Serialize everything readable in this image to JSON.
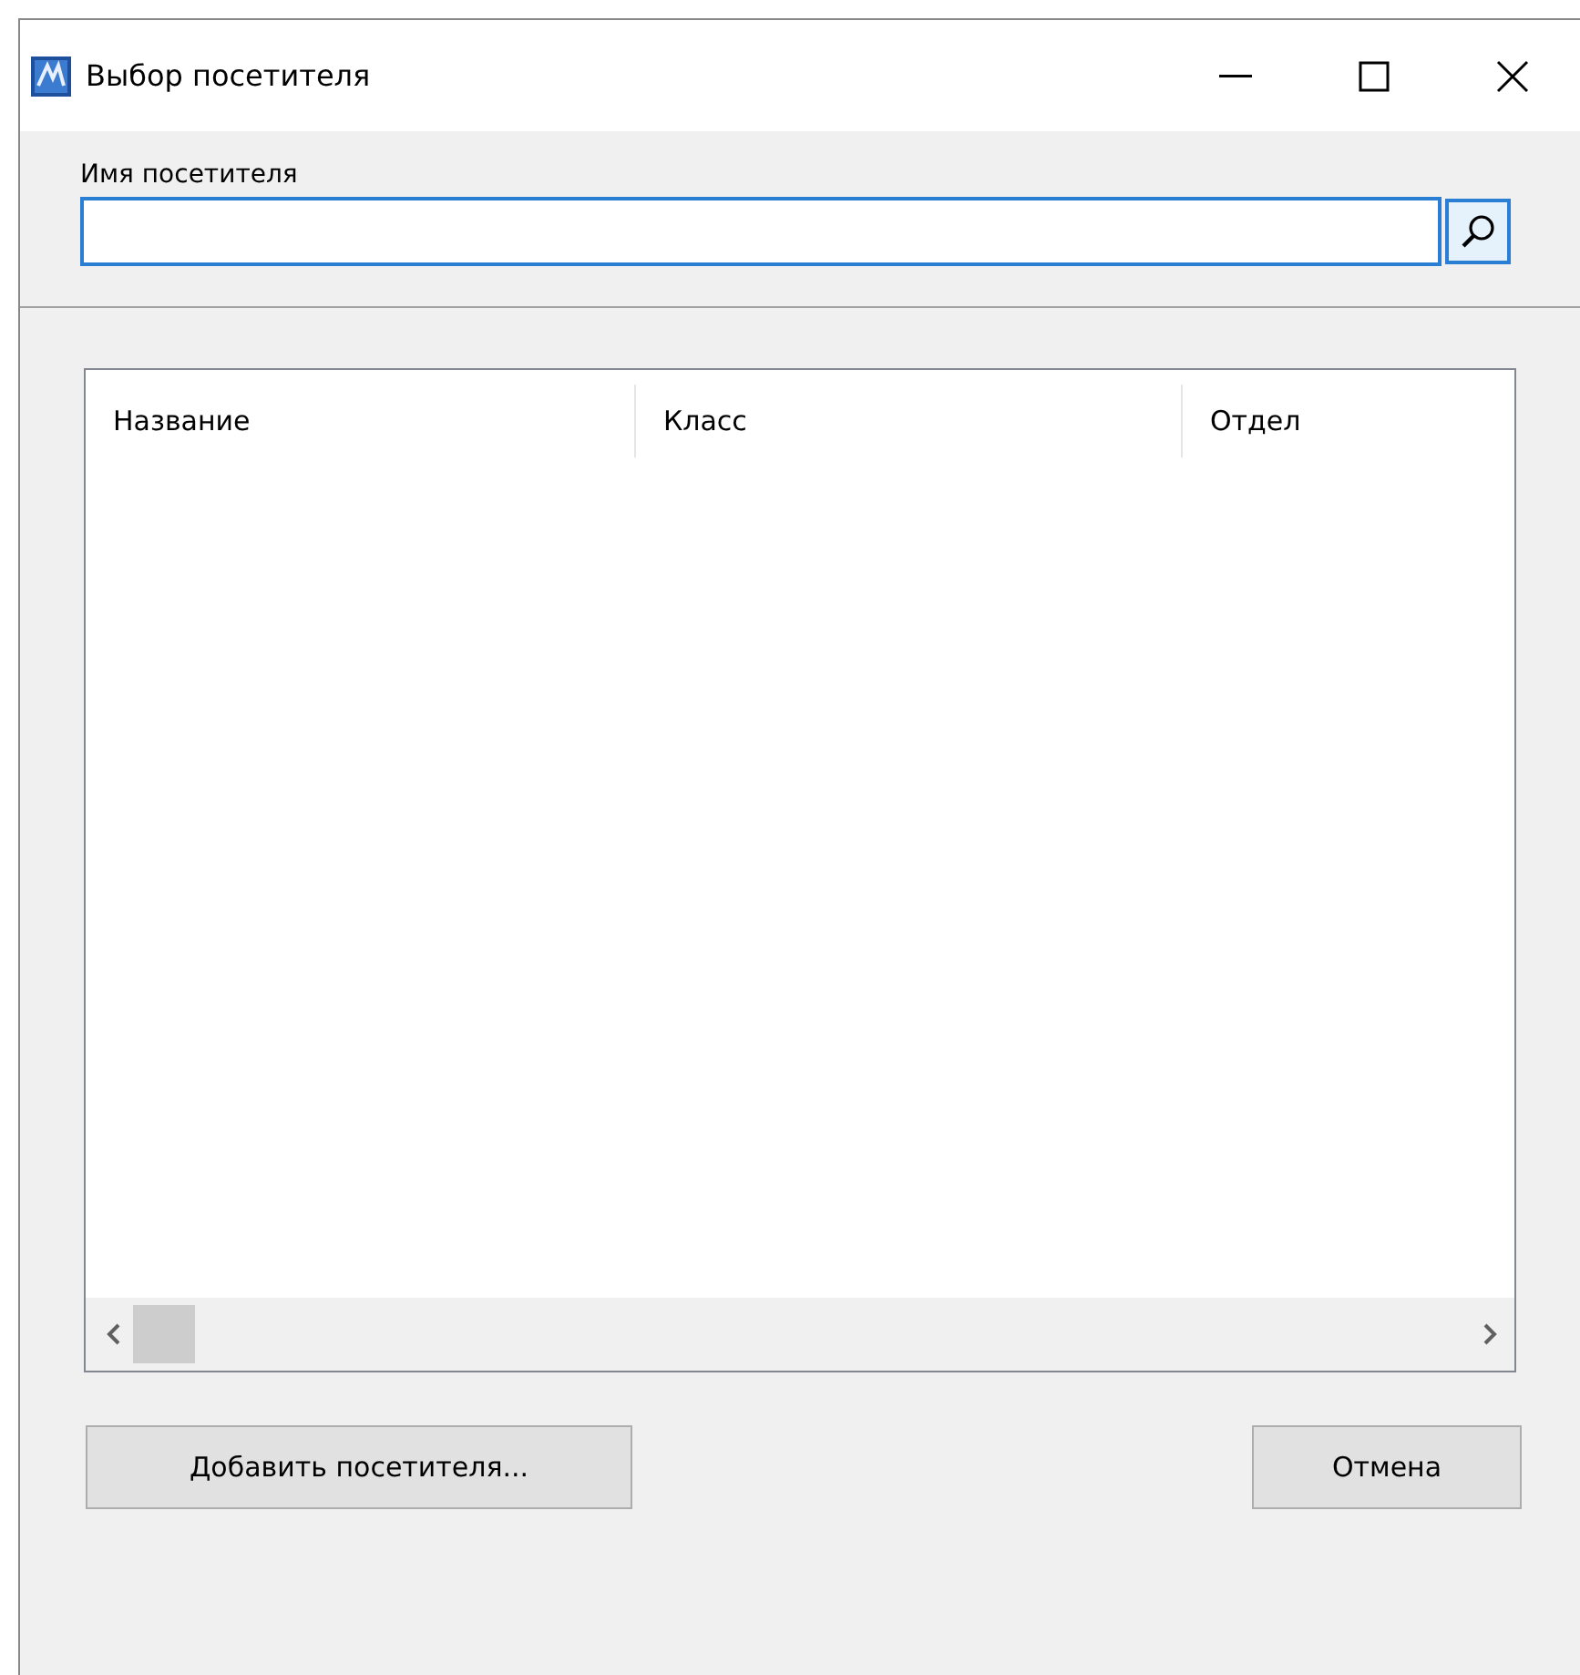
{
  "window": {
    "title": "Выбор посетителя"
  },
  "name_field": {
    "label": "Имя посетителя",
    "focused": true
  },
  "table": {
    "columns": [
      "Название",
      "Класс",
      "Отдел"
    ]
  },
  "buttons": [
    {
      "label": "Добавить посетителя..."
    },
    {
      "label": "Отмена"
    }
  ]
}
